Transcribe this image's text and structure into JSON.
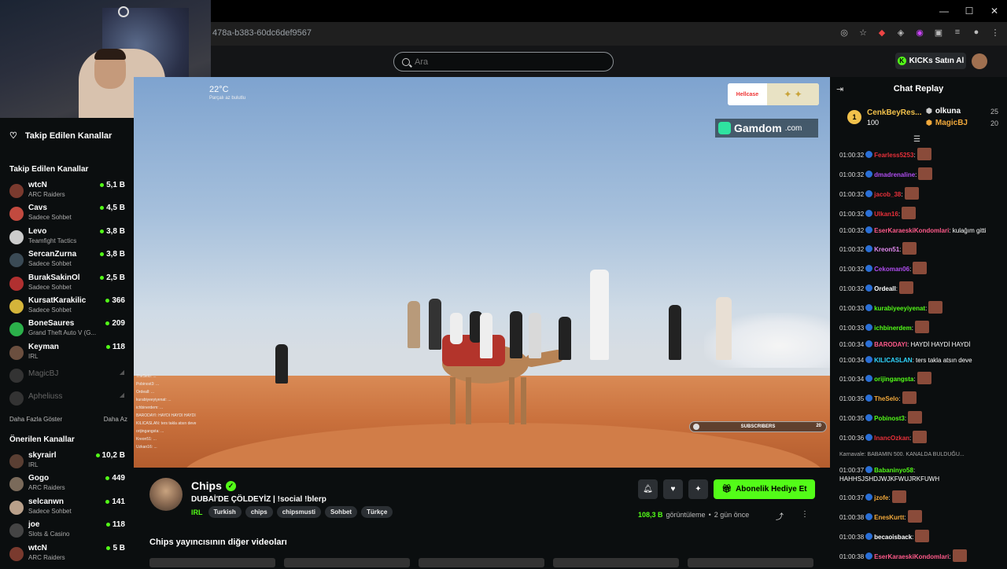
{
  "browser": {
    "url": "478a-b383-60dc6def9567",
    "window_controls": [
      "—",
      "☐",
      "✕"
    ]
  },
  "header": {
    "search_placeholder": "Ara",
    "kicks_label": "KICKs Satın Al"
  },
  "sidebar": {
    "follow_heading": "Takip Edilen Kanallar",
    "followed_title": "Takip Edilen Kanallar",
    "followed": [
      {
        "name": "wtcN",
        "category": "ARC Raiders",
        "viewers": "5,1 B",
        "color": "#7a3a2e"
      },
      {
        "name": "Cavs",
        "category": "Sadece Sohbet",
        "viewers": "4,5 B",
        "color": "#c24a3f"
      },
      {
        "name": "Levo",
        "category": "Teamfight Tactics",
        "viewers": "3,8 B",
        "color": "#ccc"
      },
      {
        "name": "SercanZurna",
        "category": "Sadece Sohbet",
        "viewers": "3,8 B",
        "color": "#3a4a55"
      },
      {
        "name": "BurakSakinOl",
        "category": "Sadece Sohbet",
        "viewers": "2,5 B",
        "color": "#b03030"
      },
      {
        "name": "KursatKarakilic",
        "category": "Sadece Sohbet",
        "viewers": "366",
        "color": "#d4b43a"
      },
      {
        "name": "BoneSaures",
        "category": "Grand Theft Auto V (G...",
        "viewers": "209",
        "color": "#2bb04a"
      },
      {
        "name": "Keyman",
        "category": "IRL",
        "viewers": "118",
        "color": "#6b4f3f"
      }
    ],
    "offline": [
      {
        "name": "MagicBJ"
      },
      {
        "name": "Apheliuss"
      }
    ],
    "show_more": "Daha Fazla Göster",
    "show_less": "Daha Az",
    "recommended_title": "Önerilen Kanallar",
    "recommended": [
      {
        "name": "skyrairl",
        "category": "IRL",
        "viewers": "10,2 B",
        "color": "#5a3f33"
      },
      {
        "name": "Gogo",
        "category": "ARC Raiders",
        "viewers": "449",
        "color": "#7a6a5a"
      },
      {
        "name": "selcanwn",
        "category": "Sadece Sohbet",
        "viewers": "141",
        "color": "#b9a08a"
      },
      {
        "name": "joe",
        "category": "Slots & Casino",
        "viewers": "118",
        "color": "#444"
      },
      {
        "name": "wtcN",
        "category": "ARC Raiders",
        "viewers": "5 B",
        "color": "#7a3a2e"
      }
    ]
  },
  "video": {
    "weather_temp": "22°C",
    "weather_sub": "Parçalı az bulutlu",
    "sponsor_left": "Hellcase",
    "sponsor_left_sub": "CHOPSCS",
    "gamdom_name": "Gamdom",
    "gamdom_tld": ".com",
    "subs_label": "SUBSCRIBERS",
    "subs_count": "20",
    "overlay_chat": [
      "TheSelo: ...",
      "Pobinost3: ...",
      "Ordeall: ...",
      "kurabiyeeyiyenat: ...",
      "ichbinerdem: ...",
      "BARODAYI: HAYDI HAYDI HAYDI",
      "KILICASLAN: ters takla atsın deve",
      "orijingangsta: ...",
      "Kreon51: ...",
      "Uzkan16: ..."
    ]
  },
  "info": {
    "streamer": "Chips",
    "title": "DUBAİ'DE ÇÖLDEYİZ | !social !blerp",
    "category": "IRL",
    "tags": [
      "Turkish",
      "chips",
      "chipsmusti",
      "Sohbet",
      "Türkçe"
    ],
    "gift_label": "Abonelik Hediye Et",
    "views_count": "108,3 B",
    "views_label": "görüntüleme",
    "age": "2 gün önce",
    "other_videos": "Chips yayıncısının diğer videoları"
  },
  "chat": {
    "title": "Chat Replay",
    "leader_first": {
      "name": "CenkBeyRes...",
      "count": "100",
      "rank": "1"
    },
    "leader_rows": [
      {
        "name": "olkuna",
        "count": "25",
        "color": "#ffffff"
      },
      {
        "name": "MagicBJ",
        "count": "20",
        "color": "#f2a93b"
      }
    ],
    "messages": [
      {
        "time": "01:00:32",
        "user": "Fearless5253",
        "color": "#e8303a",
        "text": ":",
        "emote": true
      },
      {
        "time": "01:00:32",
        "user": "dmadrenaline",
        "color": "#b04df0",
        "text": ":",
        "emote": true
      },
      {
        "time": "01:00:32",
        "user": "jacob_38",
        "color": "#e8303a",
        "text": ":",
        "emote": true
      },
      {
        "time": "01:00:32",
        "user": "Ulkan16",
        "color": "#e8303a",
        "text": ":",
        "emote": true
      },
      {
        "time": "01:00:32",
        "user": "EserKaraeskiKondomlari",
        "color": "#ff5a8a",
        "text": ": kulağım gitti",
        "emote": false
      },
      {
        "time": "01:00:32",
        "user": "Kreon51",
        "color": "#e38af0",
        "text": ":",
        "emote": true
      },
      {
        "time": "01:00:32",
        "user": "Cekoman06",
        "color": "#b04df0",
        "text": ":",
        "emote": true
      },
      {
        "time": "01:00:32",
        "user": "Ordeall",
        "color": "#ffffff",
        "text": ":",
        "emote": true
      },
      {
        "time": "01:00:33",
        "user": "kurabiyeeyiyenat",
        "color": "#53fc18",
        "text": ":",
        "emote": true
      },
      {
        "time": "01:00:33",
        "user": "ichbinerdem",
        "color": "#53fc18",
        "text": ":",
        "emote": true
      },
      {
        "time": "01:00:34",
        "user": "BARODAYI",
        "color": "#ff5a8a",
        "text": ": HAYDİ HAYDİ HAYDİ",
        "emote": false
      },
      {
        "time": "01:00:34",
        "user": "KILICASLAN",
        "color": "#2fd6ff",
        "text": ": ters takla atsın deve",
        "emote": false
      },
      {
        "time": "01:00:34",
        "user": "orijingangsta",
        "color": "#53fc18",
        "text": ":",
        "emote": true
      },
      {
        "time": "01:00:35",
        "user": "TheSelo",
        "color": "#f2a93b",
        "text": ":",
        "emote": true
      },
      {
        "time": "01:00:35",
        "user": "Pobinost3",
        "color": "#53fc18",
        "text": ":",
        "emote": true
      },
      {
        "time": "01:00:36",
        "user": "InancOzkan",
        "color": "#e8303a",
        "text": ":",
        "emote": true
      }
    ],
    "system_msg": "Karnavale: BABAMIN 500. KANALDA BULDUĞU...",
    "messages2": [
      {
        "time": "01:00:37",
        "user": "Babaninyo58",
        "color": "#53fc18",
        "text": ": HAHHSJSHDJWJKFWUJRKFUWH",
        "emote": false
      },
      {
        "time": "01:00:37",
        "user": "jzofe",
        "color": "#f2a93b",
        "text": ":",
        "emote": true
      },
      {
        "time": "01:00:38",
        "user": "EnesKurtt",
        "color": "#f2a93b",
        "text": ":",
        "emote": true
      },
      {
        "time": "01:00:38",
        "user": "becaoisback",
        "color": "#ffffff",
        "text": ":",
        "emote": true
      },
      {
        "time": "01:00:38",
        "user": "EserKaraeskiKondomlari",
        "color": "#ff5a8a",
        "text": ":",
        "emote": true
      }
    ]
  }
}
